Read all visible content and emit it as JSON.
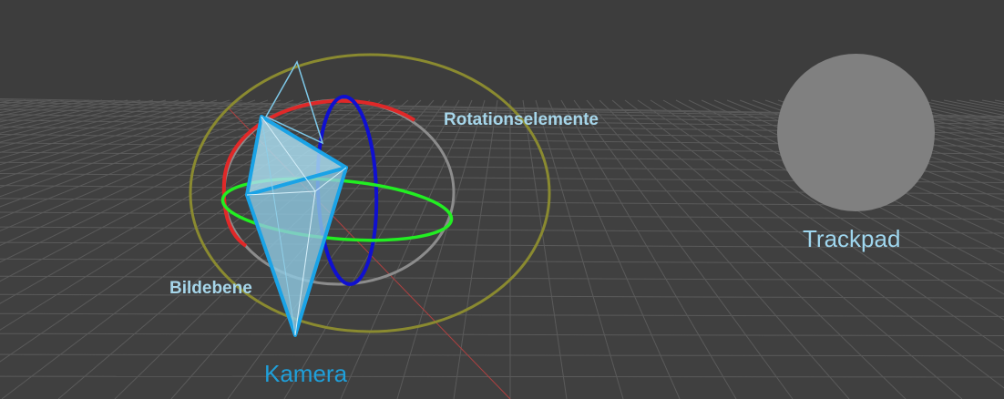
{
  "labels": {
    "rotation_elements": "Rotationselemente",
    "image_plane": "Bildebene",
    "camera": "Kamera",
    "trackpad": "Trackpad"
  },
  "colors": {
    "background": "#3c3c3c",
    "grid": "#5a5a5a",
    "x_axis": "#e03030",
    "y_axis": "#1515d0",
    "z_axis": "#22ee22",
    "outer_ring": "#8a8a30",
    "free_ring": "#8c8c8c",
    "camera_fill": "#a9dcef",
    "camera_edge": "#1aa3e6",
    "trackpad": "#808080"
  }
}
